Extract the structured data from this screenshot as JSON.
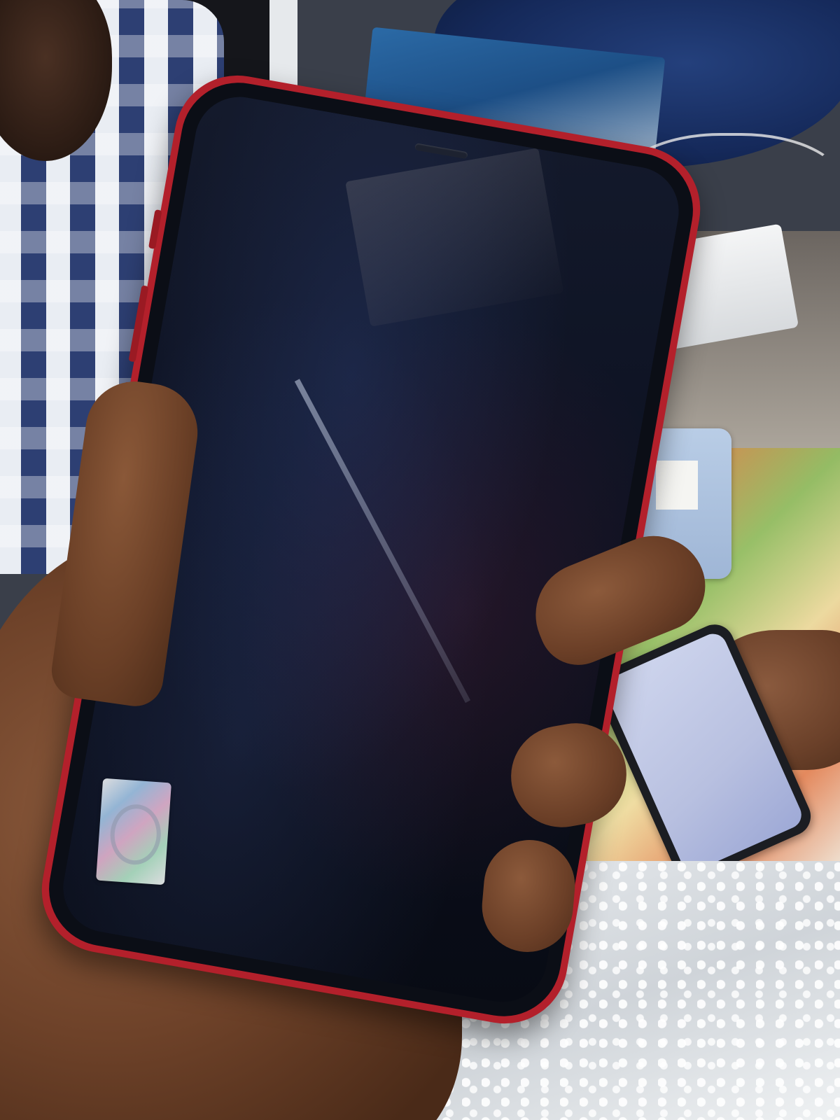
{
  "scene": {
    "subject": "phone-held-in-hand",
    "phone_color": "#b3202b",
    "screen_color": "#0b0e16",
    "screen_state": "off"
  }
}
